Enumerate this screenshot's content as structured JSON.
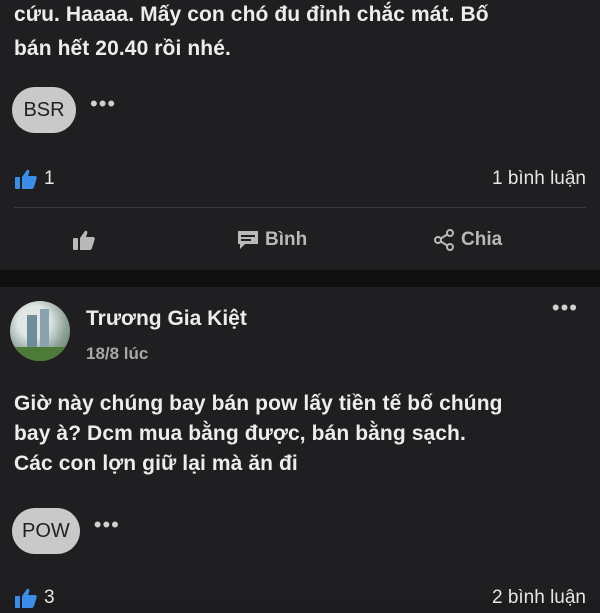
{
  "post1": {
    "text_line1": "cứu. Haaaa. Mấy con chó đu đỉnh chắc mát. Bố",
    "text_line2": "bán hết 20.40 rồi nhé.",
    "tag": "BSR",
    "more": "•••",
    "like_count": "1",
    "comment_count": "1 bình luận",
    "actions": {
      "comment": "Bình",
      "share": "Chia"
    }
  },
  "post2": {
    "author": "Trương Gia Kiệt",
    "time": "18/8 lúc",
    "menu": "•••",
    "text_line1": "Giờ này chúng bay bán pow lấy tiền tế bố chúng",
    "text_line2": "bay à?  Dcm mua bằng được, bán bằng sạch.",
    "text_line3": "Các con lợn giữ lại mà ăn đi",
    "tag": "POW",
    "more": "•••",
    "like_count": "3",
    "comment_count": "2 bình luận"
  },
  "colors": {
    "background": "#1f1f21",
    "separator": "#0f0f10",
    "like_blue": "#3b8ee8",
    "chip": "#c9c9c9"
  },
  "icons": {
    "like": "thumbs-up-icon",
    "comment": "comment-icon",
    "share": "share-icon"
  }
}
